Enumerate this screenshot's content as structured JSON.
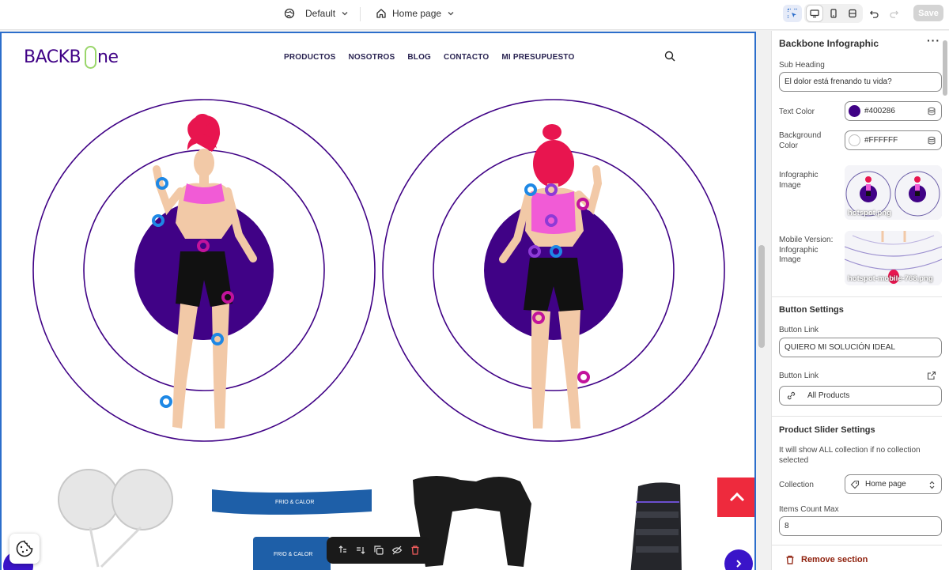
{
  "topbar": {
    "theme_label": "Default",
    "page_label": "Home page",
    "save_label": "Save"
  },
  "store": {
    "logo_text": "BACKBONE",
    "nav": [
      "PRODUCTOS",
      "NOSOTROS",
      "BLOG",
      "CONTACTO",
      "MI PRESUPUESTO"
    ]
  },
  "panel": {
    "title": "Backbone Infographic",
    "sub_heading_label": "Sub Heading",
    "sub_heading_value": "El dolor está frenando tu  vida?",
    "text_color_label": "Text Color",
    "text_color_value": "#400286",
    "bg_color_label": "Background Color",
    "bg_color_value": "#FFFFFF",
    "infographic_image_label": "Infographic Image",
    "infographic_image_file": "hotspot.png",
    "mobile_image_label": "Mobile Version: Infographic Image",
    "mobile_image_file": "hotspot-mobile-768.png",
    "button_settings_heading": "Button Settings",
    "button_link_label_1": "Button Link",
    "button_link_value_1": "QUIERO MI SOLUCIÓN IDEAL",
    "button_link_label_2": "Button Link",
    "button_link_value_2": "All Products",
    "product_slider_heading": "Product Slider Settings",
    "product_slider_help": "It will show ALL collection if no collection selected",
    "collection_label": "Collection",
    "collection_value": "Home page",
    "items_count_label": "Items Count Max",
    "items_count_value": "8",
    "remove_label": "Remove section"
  },
  "colors": {
    "brand_purple": "#400286",
    "accent_blue": "#2c6ecb",
    "hotspot_blue": "#1e88e5",
    "hotspot_magenta": "#c2139c",
    "scroll_top_red": "#ee2a3d"
  },
  "icons": [
    "globe-icon",
    "chevron-down-icon",
    "home-icon",
    "select-element-icon",
    "desktop-icon",
    "mobile-icon",
    "fullwidth-icon",
    "undo-icon",
    "redo-icon",
    "search-icon",
    "more-icon",
    "database-icon",
    "external-link-icon",
    "link-icon",
    "chevron-updown-icon",
    "trash-icon",
    "cookie-icon",
    "arrow-up-icon",
    "arrow-right-icon"
  ]
}
